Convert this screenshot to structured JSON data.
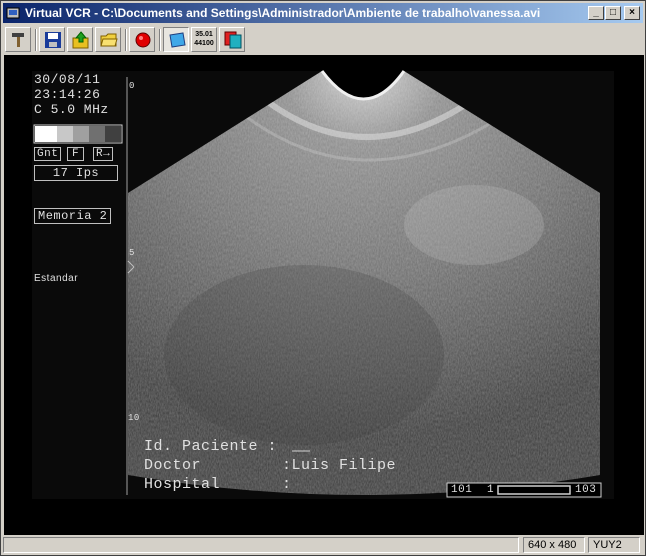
{
  "window": {
    "title": "Virtual VCR - C:\\Documents and Settings\\Administrador\\Ambiente de trabalho\\vanessa.avi",
    "minimize": "_",
    "maximize": "□",
    "close": "×"
  },
  "toolbar": {
    "buttons": [
      {
        "name": "settings-tools"
      },
      {
        "name": "save"
      },
      {
        "name": "upload"
      },
      {
        "name": "open-folder"
      },
      {
        "name": "record"
      },
      {
        "name": "preview"
      },
      {
        "name": "counter",
        "line1": "35.01",
        "line2": "44100"
      },
      {
        "name": "overlay"
      }
    ]
  },
  "video": {
    "date": "30/08/11",
    "time": "23:14:26",
    "probe": "C 5.0 MHz",
    "controls": [
      "Gnt",
      "F",
      "R→"
    ],
    "fps": "17 Ips",
    "memory": "Memoria 2",
    "preset": "Estandar",
    "depth_marks": [
      "0",
      "5",
      "10"
    ],
    "patient_id_label": "Id. Paciente :",
    "doctor_label": "Doctor",
    "doctor_value": ":Luis Filipe",
    "hospital_label": "Hospital",
    "hospital_value": ":",
    "scale_left": "101",
    "scale_mid": "1",
    "scale_right": "103"
  },
  "status": {
    "main": "",
    "resolution": "640 x 480",
    "format": "YUY2"
  },
  "colors": {
    "title_start": "#0a246a",
    "title_end": "#a6caf0",
    "chrome": "#d4d0c8",
    "record": "#e00000"
  }
}
